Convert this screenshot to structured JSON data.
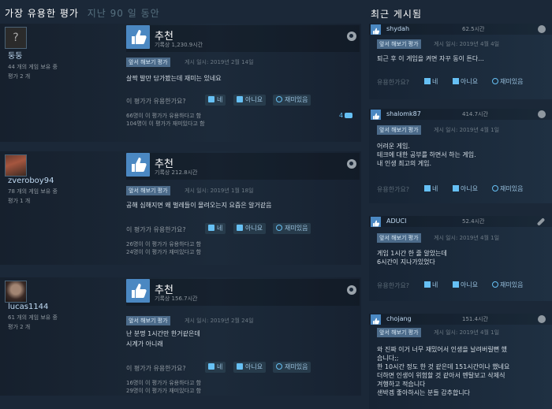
{
  "header": {
    "title": "가장 유용한 평가",
    "period": "지난 90 일 동안",
    "recent_title": "최근 게시됨"
  },
  "reviews": [
    {
      "author": "둥둥",
      "owned": "44 개의 게임 보유 중",
      "review_count": "평가 2 개",
      "verdict": "추천",
      "hours": "기록상 1,230.9시간",
      "early_access": "앞서 해보기 평가",
      "posted": "게시 일시: 2019년 2월 14일",
      "text": "살짝 발만 담가봤는데 재미는 있네요",
      "helpful_q": "이 평가가 유용한가요?",
      "yes": "네",
      "no": "아니요",
      "funny": "재미있음",
      "stat1": "66명이 이 평가가 유용하다고 함",
      "stat2": "104명이 이 평가가 재미있다고 함",
      "comments": "4"
    },
    {
      "author": "zveroboy94",
      "owned": "78 개의 게임 보유 중",
      "review_count": "평가 1 개",
      "verdict": "추천",
      "hours": "기록상 212.8시간",
      "early_access": "앞서 해보기 평가",
      "posted": "게시 일시: 2019년 1월 18일",
      "text": "공해 심해지면 왜 벌레들이 몰려오는지 요즘은 알거같음",
      "helpful_q": "이 평가가 유용한가요?",
      "yes": "네",
      "no": "아니요",
      "funny": "재미있음",
      "stat1": "26명이 이 평가가 유용하다고 함",
      "stat2": "24명이 이 평가가 재미있다고 함"
    },
    {
      "author": "lucas1144",
      "owned": "61 개의 게임 보유 중",
      "review_count": "평가 2 개",
      "verdict": "추천",
      "hours": "기록상 156.7시간",
      "early_access": "앞서 해보기 평가",
      "posted": "게시 일시: 2019년 2월 24일",
      "text1": "난 분명 1시간만 한거같은데",
      "text2": "시계가 아니래",
      "helpful_q": "이 평가가 유용한가요?",
      "yes": "네",
      "no": "아니요",
      "funny": "재미있음",
      "stat1": "16명이 이 평가가 유용하다고 함",
      "stat2": "29명이 이 평가가 재미있다고 함"
    }
  ],
  "recent": [
    {
      "user": "shydah",
      "hours": "62.5시간",
      "early_access": "앞서 해보기 평가",
      "posted": "게시 일시: 2019년 4월 4일",
      "lines": [
        "퇴근 후 이 게임을 켜면 자꾸 동이 튼다..."
      ],
      "helpful_q": "유용한가요?",
      "yes": "네",
      "no": "아니요",
      "funny": "재미있음"
    },
    {
      "user": "shalomk87",
      "hours": "414.7시간",
      "early_access": "앞서 해보기 평가",
      "posted": "게시 일시: 2019년 4월 1일",
      "lines": [
        "어려운 게임.",
        "테크에 대한 공부를 하면서 하는 게임.",
        "내 인생 최고의 게임."
      ],
      "helpful_q": "유용한가요?",
      "yes": "네",
      "no": "아니요",
      "funny": "재미있음"
    },
    {
      "user": "ADUCI",
      "hours": "52.4시간",
      "early_access": "앞서 해보기 평가",
      "posted": "게시 일시: 2019년 4월 1일",
      "lines": [
        "게임 1시간 한 줄 알았는데",
        "6시간이 지나가있었다"
      ],
      "helpful_q": "유용한가요?",
      "yes": "네",
      "no": "아니요",
      "funny": "재미있음"
    },
    {
      "user": "chojang",
      "hours": "151.4시간",
      "early_access": "앞서 해보기 평가",
      "posted": "게시 일시: 2019년 4월 1일",
      "lines": [
        "와 진짜 이거 너무 재밌어서 인생을 날려버릴뻔 했",
        "습니다;;",
        "한 10시간 정도 한 것 같은데 151시간이나 했네요",
        "더하면 인생이 위험할 것 같아서 멘탈보고 삭제식",
        "겨행하고 적습니다",
        "샌박겜 좋아하시는 분들 감추합니다"
      ]
    }
  ],
  "colors": {
    "background": "#1b2838",
    "accent": "#66c0f4",
    "thumb": "#4b88c2"
  }
}
